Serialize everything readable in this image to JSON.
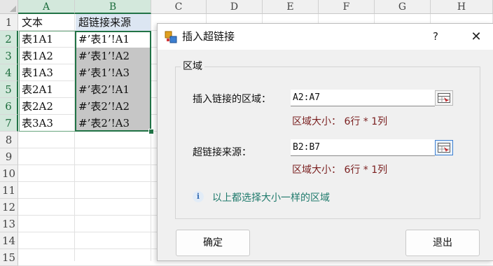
{
  "spreadsheet": {
    "columns": [
      "A",
      "B",
      "C",
      "D",
      "E",
      "F",
      "G",
      "H"
    ],
    "selected_columns": [
      "A",
      "B"
    ],
    "rows": [
      "1",
      "2",
      "3",
      "4",
      "5",
      "6",
      "7",
      "8",
      "9",
      "10",
      "11",
      "12",
      "13",
      "14",
      "15"
    ],
    "selected_rows": [
      "2",
      "3",
      "4",
      "5",
      "6",
      "7"
    ],
    "header_row": {
      "a": "文本",
      "b": "超链接来源"
    },
    "data_rows": [
      {
        "a": "表1A1",
        "b": "#’表1’!A1"
      },
      {
        "a": "表1A2",
        "b": "#’表1’!A2"
      },
      {
        "a": "表1A3",
        "b": "#’表1’!A3"
      },
      {
        "a": "表2A1",
        "b": "#’表2’!A1"
      },
      {
        "a": "表2A2",
        "b": "#’表2’!A2"
      },
      {
        "a": "表3A3",
        "b": "#’表2’!A3"
      }
    ],
    "colors": {
      "selection_border": "#217346",
      "header_fill": "#dce6f2",
      "shade_fill": "#c6c6c6"
    }
  },
  "dialog": {
    "title": "插入超链接",
    "help_label": "?",
    "close_label": "✕",
    "group_title": "区域",
    "insert_area": {
      "label": "插入链接的区域：",
      "value": "A2:A7",
      "size_text": "区域大小： 6行 * 1列"
    },
    "source": {
      "label": "超链接来源：",
      "value": "B2:B7",
      "size_text": "区域大小： 6行 * 1列"
    },
    "info_icon": "info-icon",
    "info_text": "以上都选择大小一样的区域",
    "ok_label": "确定",
    "exit_label": "退出",
    "colors": {
      "size_text": "#7a1f1f",
      "info_text": "#1f7a6c"
    }
  }
}
